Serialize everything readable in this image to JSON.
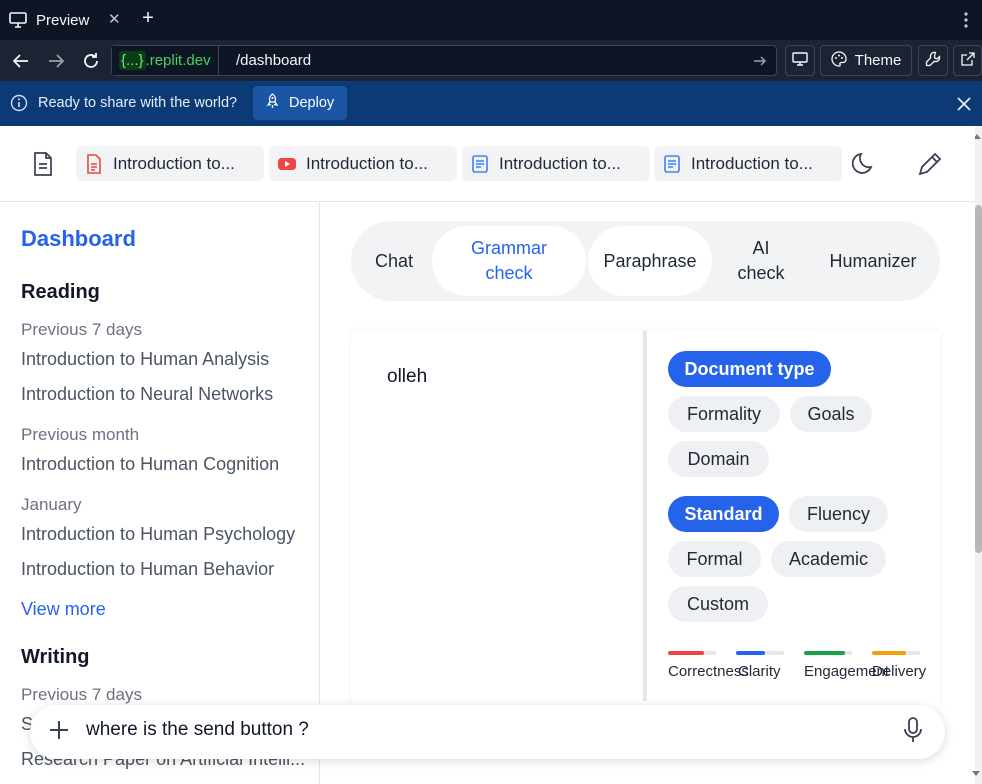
{
  "browser": {
    "tab_label": "Preview",
    "tab_close": "✕",
    "new_tab": "+",
    "domain_brace": "{...}",
    "domain_rest": ".replit.dev",
    "path": "/dashboard",
    "theme_label": "Theme"
  },
  "deploy_bar": {
    "message": "Ready to share with the world?",
    "button": "Deploy"
  },
  "doc_tabs": [
    {
      "label": "Introduction to...",
      "icon": "pdf-icon",
      "color": "#ef4444"
    },
    {
      "label": "Introduction to...",
      "icon": "youtube-icon",
      "color": "#ef4444"
    },
    {
      "label": "Introduction to...",
      "icon": "doc-icon",
      "color": "#3b82f6"
    },
    {
      "label": "Introduction to...",
      "icon": "doc-icon",
      "color": "#3b82f6"
    }
  ],
  "sidebar": {
    "title": "Dashboard",
    "reading_heading": "Reading",
    "reading_groups": [
      {
        "label": "Previous 7 days",
        "items": [
          "Introduction to Human Analysis",
          "Introduction to Neural Networks"
        ]
      },
      {
        "label": "Previous month",
        "items": [
          "Introduction to Human Cognition"
        ]
      },
      {
        "label": "January",
        "items": [
          "Introduction to Human Psychology",
          "Introduction to Human Behavior"
        ]
      }
    ],
    "view_more": "View more",
    "writing_heading": "Writing",
    "writing_group": "Previous 7 days",
    "writing_item_partial": "S",
    "writing_item_last": "Research Paper on Artificial Intelli..."
  },
  "modes": [
    "Chat",
    "Grammar check",
    "Paraphrase",
    "AI check",
    "Humanizer"
  ],
  "active_mode": "Grammar check",
  "editor": {
    "text": "olleh"
  },
  "options": {
    "doc_chips": [
      "Document type",
      "Formality",
      "Goals",
      "Domain"
    ],
    "style_chips": [
      "Standard",
      "Fluency",
      "Formal",
      "Academic",
      "Custom"
    ],
    "selected_doc": "Document type",
    "selected_style": "Standard"
  },
  "metrics": [
    {
      "label": "Correctness",
      "color": "#ef4444",
      "level": 0.75
    },
    {
      "label": "Clarity",
      "color": "#2563eb",
      "level": 0.6
    },
    {
      "label": "Engagement",
      "color": "#16a34a",
      "level": 0.85
    },
    {
      "label": "Delivery",
      "color": "#f59e0b",
      "level": 0.7
    }
  ],
  "prompt": {
    "text": "where is the send button ?"
  },
  "colors": {
    "accent": "#2563eb",
    "chrome_bg": "#0e1525",
    "deploy_bg": "#0b3a74"
  }
}
